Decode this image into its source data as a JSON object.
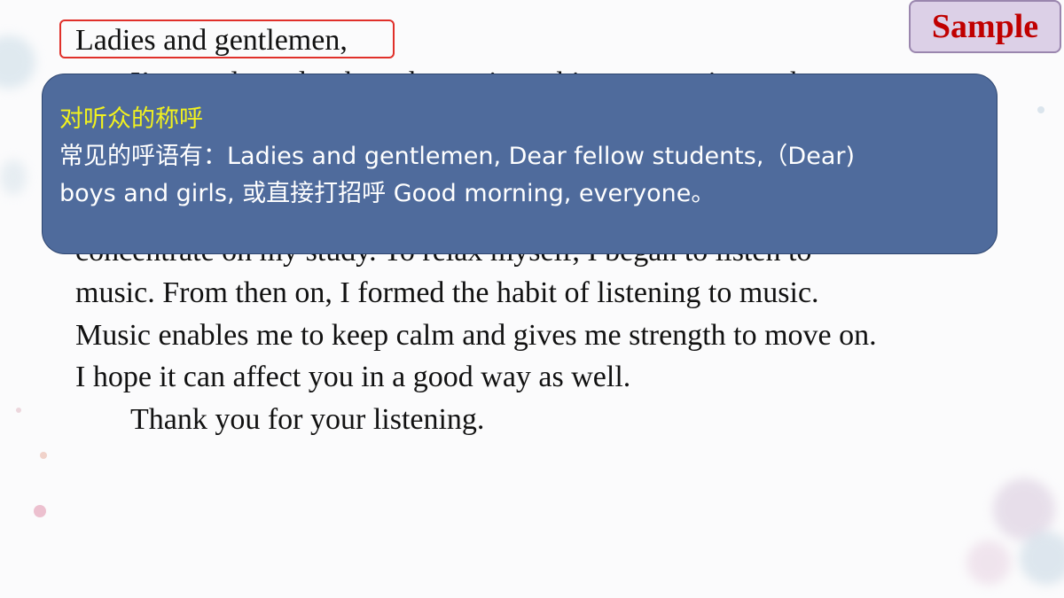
{
  "badge": {
    "label": "Sample"
  },
  "speech": {
    "greeting": "Ladies and gentlemen,",
    "lines": [
      "I’m so pleased to have been given this opportunity to share my",
      "",
      "",
      "",
      "concentrate on my study. To relax myself, I began to listen to",
      "music. From then on, I formed the habit of listening to music.",
      "Music enables me to keep calm and gives me strength to move on.",
      "I hope it can affect you in a good way as well.",
      "Thank you for your listening."
    ]
  },
  "callout": {
    "heading": "对听众的称呼",
    "body_line1": "常见的呼语有：Ladies and gentlemen, Dear fellow students,（Dear)",
    "body_line2": "boys and girls, 或直接打招呼 Good morning, everyone。"
  },
  "colors": {
    "callout_bg": "#4f6b9c",
    "callout_heading": "#f2f21e",
    "badge_text": "#c00000",
    "highlight_border": "#e0302a"
  }
}
